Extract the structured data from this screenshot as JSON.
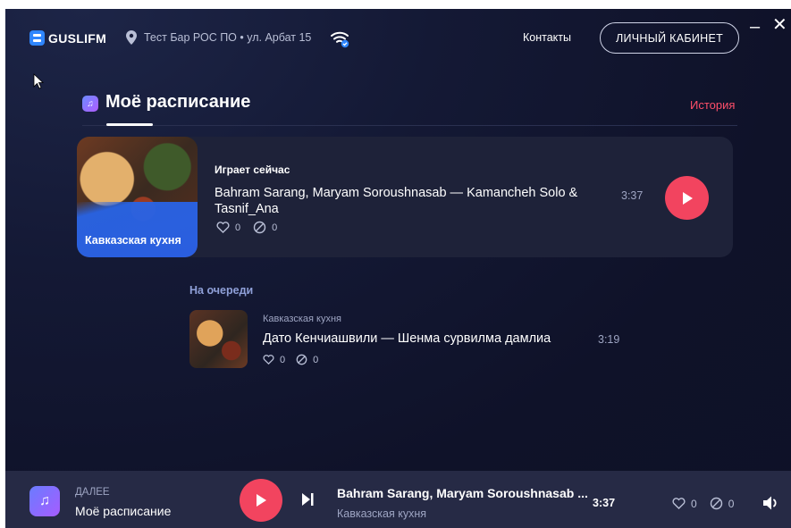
{
  "header": {
    "logo_text": "GUSLIFM",
    "location": "Тест Бар РОС ПО • ул. Арбат 15",
    "contacts_label": "Контакты",
    "cabinet_label": "ЛИЧНЫЙ КАБИНЕТ",
    "minimize_label": "–",
    "close_label": "✕"
  },
  "section": {
    "title": "Моё расписание",
    "history_label": "История"
  },
  "now_playing": {
    "kicker": "Играет сейчас",
    "title": "Bahram Sarang, Maryam Soroushnasab — Kamancheh Solo & Tasnif_Ana",
    "cover_label": "Кавказская кухня",
    "likes": "0",
    "blocks": "0",
    "duration": "3:37"
  },
  "queue": {
    "heading": "На очереди",
    "items": [
      {
        "category": "Кавказская кухня",
        "title": "Дато Кенчиашвили — Шенма сурвилма дамлиа",
        "likes": "0",
        "blocks": "0",
        "duration": "3:19"
      }
    ]
  },
  "player": {
    "next_label": "ДАЛЕЕ",
    "next_title": "Моё расписание",
    "track": "Bahram Sarang, Maryam Soroushnasab ...",
    "category": "Кавказская кухня",
    "duration": "3:37",
    "likes": "0",
    "blocks": "0"
  },
  "colors": {
    "accent": "#f2445f",
    "history_link": "#ff4f6a",
    "background": "#0f1229",
    "card": "#1e2239",
    "player_bar": "#262a45",
    "queue_heading": "#8fa0d8"
  },
  "icons": {
    "logo": "logo-mark-icon",
    "location": "map-pin-icon",
    "wifi": "wifi-check-icon",
    "section": "music-note-icon",
    "like": "heart-icon",
    "block": "block-icon",
    "play": "play-icon",
    "skip": "skip-next-icon",
    "volume": "volume-icon"
  }
}
